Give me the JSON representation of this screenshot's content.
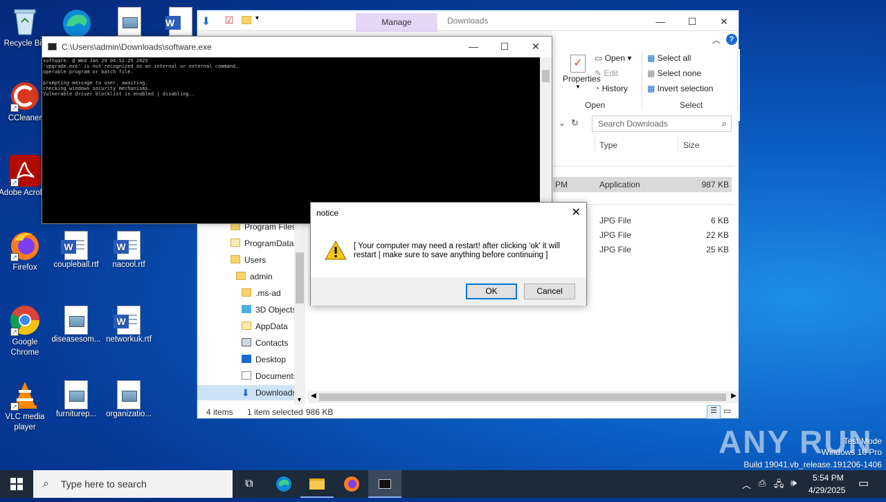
{
  "desktop": {
    "icons": [
      {
        "label": "Recycle Bin",
        "icon": "recycle-bin-icon"
      },
      {
        "label": "CCleaner",
        "icon": "ccleaner-icon"
      },
      {
        "label": "Adobe Acrobat",
        "icon": "adobe-acrobat-icon"
      },
      {
        "label": "Firefox",
        "icon": "firefox-icon"
      },
      {
        "label": "coupleball.rtf",
        "icon": "word-doc-icon"
      },
      {
        "label": "nacool.rtf",
        "icon": "word-doc-icon"
      },
      {
        "label": "Google Chrome",
        "icon": "chrome-icon"
      },
      {
        "label": "diseasesom...",
        "icon": "image-file-icon"
      },
      {
        "label": "networkuk.rtf",
        "icon": "word-doc-icon"
      },
      {
        "label": "VLC media player",
        "icon": "vlc-icon"
      },
      {
        "label": "furniturep...",
        "icon": "image-file-icon"
      },
      {
        "label": "organizatio...",
        "icon": "image-file-icon"
      }
    ]
  },
  "explorer": {
    "manage_tab": "Manage",
    "title": "Downloads",
    "ribbon": {
      "properties": "Properties",
      "open": "Open",
      "edit": "Edit",
      "history": "History",
      "open_group": "Open",
      "select_all": "Select all",
      "select_none": "Select none",
      "invert_selection": "Invert selection",
      "select_group": "Select"
    },
    "search_placeholder": "Search Downloads",
    "columns": {
      "type": "Type",
      "size": "Size"
    },
    "files": [
      {
        "date_fragment": "PM",
        "type": "Application",
        "size": "987 KB"
      },
      {
        "type": "JPG File",
        "size": "6 KB"
      },
      {
        "type": "JPG File",
        "size": "22 KB"
      },
      {
        "type": "JPG File",
        "size": "25 KB"
      }
    ],
    "nav": [
      "Program Files",
      "ProgramData",
      "Users",
      "admin",
      ".ms-ad",
      "3D Objects",
      "AppData",
      "Contacts",
      "Desktop",
      "Documents",
      "Downloads"
    ],
    "status": {
      "items": "4 items",
      "selected": "1 item selected",
      "size": "986 KB"
    }
  },
  "console": {
    "title": "C:\\Users\\admin\\Downloads\\software.exe",
    "lines": [
      "software: @ Wed Jan 29 04:52:25 2025",
      "'upgrade.exe' is not recognized as an internal or external command,",
      "operable program or batch file.",
      "",
      "prompting message to user, awaiting.",
      "checking windows security mechanisms.",
      "Vulnerable driver blocklist is enabled | disabling.."
    ]
  },
  "dialog": {
    "title": "notice",
    "message": "[ Your computer may need a restart! after clicking 'ok' it will restart | make sure to save anything before continuing ]",
    "ok": "OK",
    "cancel": "Cancel"
  },
  "taskbar": {
    "search_placeholder": "Type here to search",
    "time": "5:54 PM",
    "date": "4/29/2025"
  },
  "watermark": {
    "line1": "Test Mode",
    "line2": "Windows 10 Pro",
    "line3": "Build 19041.vb_release.191206-1406",
    "brand": "ANY RUN"
  }
}
